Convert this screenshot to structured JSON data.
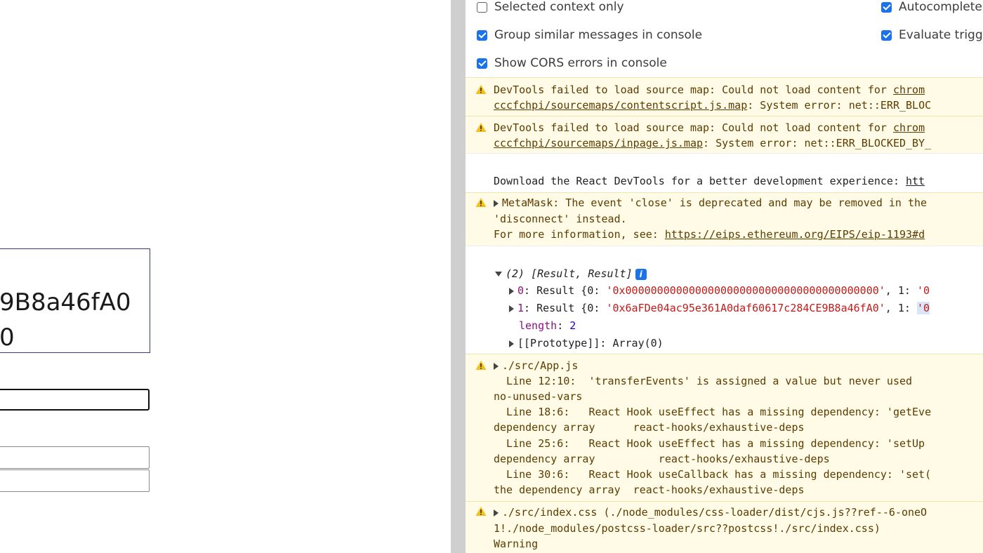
{
  "page": {
    "address_lines": [
      "9B8a46fA0",
      "0"
    ]
  },
  "devtools": {
    "settings": [
      {
        "label": "Selected context only",
        "checked": false
      },
      {
        "label": "Autocomplete",
        "checked": true
      },
      {
        "label": "Group similar messages in console",
        "checked": true
      },
      {
        "label": "Evaluate trigg",
        "checked": true
      },
      {
        "label": "Show CORS errors in console",
        "checked": true
      }
    ],
    "messages": {
      "sourcemap1": {
        "line1": "DevTools failed to load source map: Could not load content for ",
        "line1_link": "chrom",
        "line2_link": "cccfchpi/sourcemaps/contentscript.js.map",
        "line2_rest": ": System error: net::ERR_BLOC"
      },
      "sourcemap2": {
        "line1": "DevTools failed to load source map: Could not load content for ",
        "line1_link": "chrom",
        "line2_link": "cccfchpi/sourcemaps/inpage.js.map",
        "line2_rest": ": System error: net::ERR_BLOCKED_BY_"
      },
      "react_devtools": {
        "text": "Download the React DevTools for a better development experience: ",
        "link": "htt"
      },
      "metamask": {
        "line1": "MetaMask: The event 'close' is deprecated and may be removed in the",
        "line2": "'disconnect' instead.",
        "line3": "For more information, see: ",
        "line3_link": "https://eips.ethereum.org/EIPS/eip-1193#d"
      },
      "result_array": {
        "header": "(2) [Result, Result]",
        "info": "i",
        "row0_key": "0",
        "row0_type": "Result {0: ",
        "row0_str": "'0x0000000000000000000000000000000000000000'",
        "row0_tail": ", 1: ",
        "row0_tail2": "'0",
        "row1_key": "1",
        "row1_type": "Result {0: ",
        "row1_str": "'0x6aFDe04ac95e361A0daf60617c284CE9B8a46fA0'",
        "row1_tail": ", 1: ",
        "row1_tail2": "'0",
        "length_key": "length",
        "length_colon": ": ",
        "length_val": "2",
        "proto": "[[Prototype]]: Array(0)"
      },
      "appjs": {
        "title": "./src/App.js",
        "lines": [
          "  Line 12:10:  'transferEvents' is assigned a value but never used",
          "no-unused-vars",
          "  Line 18:6:   React Hook useEffect has a missing dependency: 'getEve",
          "dependency array      react-hooks/exhaustive-deps",
          "  Line 25:6:   React Hook useEffect has a missing dependency: 'setUp",
          "dependency array          react-hooks/exhaustive-deps",
          "  Line 30:6:   React Hook useCallback has a missing dependency: 'set(",
          "the dependency array  react-hooks/exhaustive-deps"
        ]
      },
      "indexcss": {
        "title": "./src/index.css (./node_modules/css-loader/dist/cjs.js??ref--6-oneO",
        "line2": "1!./node_modules/postcss-loader/src??postcss!./src/index.css)",
        "line3": "Warning"
      }
    }
  }
}
